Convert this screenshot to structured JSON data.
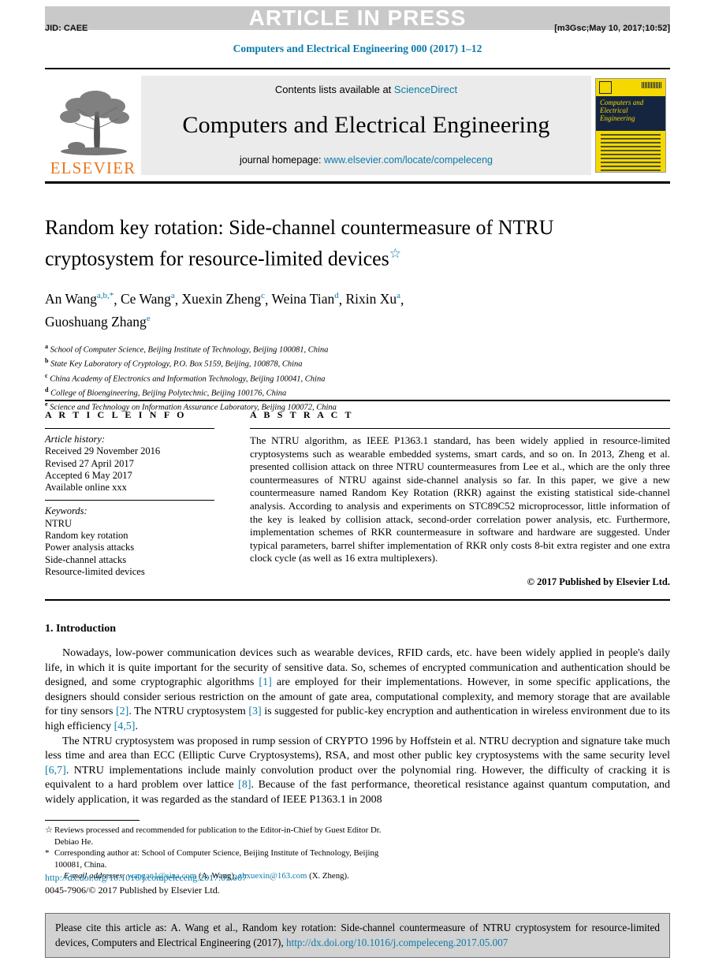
{
  "banner": {
    "article_in_press": "ARTICLE IN PRESS",
    "jid": "JID: CAEE",
    "revision_tag": "[m3Gsc;May 10, 2017;10:52]"
  },
  "journal_ref": "Computers and Electrical Engineering 000 (2017) 1–12",
  "masthead": {
    "publisher": "ELSEVIER",
    "contents_prefix": "Contents lists available at ",
    "contents_link": "ScienceDirect",
    "journal_title": "Computers and Electrical Engineering",
    "homepage_prefix": "journal homepage: ",
    "homepage_link": "www.elsevier.com/locate/compeleceng",
    "cover_title_line1": "Computers and",
    "cover_title_line2": "Electrical Engineering"
  },
  "article": {
    "title": "Random key rotation: Side-channel countermeasure of NTRU cryptosystem for resource-limited devices",
    "title_footnote_mark": "☆",
    "authors": [
      {
        "name": "An Wang",
        "sup": "a,b,*"
      },
      {
        "name": "Ce Wang",
        "sup": "a"
      },
      {
        "name": "Xuexin Zheng",
        "sup": "c"
      },
      {
        "name": "Weina Tian",
        "sup": "d"
      },
      {
        "name": "Rixin Xu",
        "sup": "a"
      },
      {
        "name": "Guoshuang Zhang",
        "sup": "e"
      }
    ],
    "affiliations": [
      {
        "mark": "a",
        "text": "School of Computer Science, Beijing Institute of Technology, Beijing 100081, China"
      },
      {
        "mark": "b",
        "text": "State Key Laboratory of Cryptology, P.O. Box 5159, Beijing, 100878, China"
      },
      {
        "mark": "c",
        "text": "China Academy of Electronics and Information Technology, Beijing 100041, China"
      },
      {
        "mark": "d",
        "text": "College of Bioengineering, Beijing Polytechnic, Beijing 100176, China"
      },
      {
        "mark": "e",
        "text": "Science and Technology on Information Assurance Laboratory, Beijing 100072, China"
      }
    ]
  },
  "article_info": {
    "heading": "A R T I C L E   I N F O",
    "history_label": "Article history:",
    "history": [
      "Received 29 November 2016",
      "Revised 27 April 2017",
      "Accepted 6 May 2017",
      "Available online xxx"
    ],
    "keywords_label": "Keywords:",
    "keywords": [
      "NTRU",
      "Random key rotation",
      "Power analysis attacks",
      "Side-channel attacks",
      "Resource-limited devices"
    ]
  },
  "abstract": {
    "heading": "A B S T R A C T",
    "text": "The NTRU algorithm, as IEEE P1363.1 standard, has been widely applied in resource-limited cryptosystems such as wearable embedded systems, smart cards, and so on. In 2013, Zheng et al. presented collision attack on three NTRU countermeasures from Lee et al., which are the only three countermeasures of NTRU against side-channel analysis so far. In this paper, we give a new countermeasure named Random Key Rotation (RKR) against the existing statistical side-channel analysis. According to analysis and experiments on STC89C52 microprocessor, little information of the key is leaked by collision attack, second-order correlation power analysis, etc. Furthermore, implementation schemes of RKR countermeasure in software and hardware are suggested. Under typical parameters, barrel shifter implementation of RKR only costs 8-bit extra register and one extra clock cycle (as well as 16 extra multiplexers).",
    "copyright": "© 2017 Published by Elsevier Ltd."
  },
  "introduction": {
    "heading": "1. Introduction",
    "paragraph1_a": "Nowadays, low-power communication devices such as wearable devices, RFID cards, etc. have been widely applied in people's daily life, in which it is quite important for the security of sensitive data. So, schemes of encrypted communication and authentication should be designed, and some cryptographic algorithms ",
    "ref1": "[1]",
    "paragraph1_b": " are employed for their implementations. However, in some specific applications, the designers should consider serious restriction on the amount of gate area, computational complexity, and memory storage that are available for tiny sensors ",
    "ref2": "[2]",
    "paragraph1_c": ". The NTRU cryptosystem ",
    "ref3": "[3]",
    "paragraph1_d": " is suggested for public-key encryption and authentication in wireless environment due to its high efficiency ",
    "ref45": "[4,5]",
    "paragraph1_e": ".",
    "paragraph2_a": "The NTRU cryptosystem was proposed in rump session of CRYPTO 1996 by Hoffstein et al. NTRU decryption and signature take much less time and area than ECC (Elliptic Curve Cryptosystems), RSA, and most other public key cryptosystems with the same security level ",
    "ref67": "[6,7]",
    "paragraph2_b": ". NTRU implementations include mainly convolution product over the polynomial ring. However, the difficulty of cracking it is equivalent to a hard problem over lattice ",
    "ref8": "[8]",
    "paragraph2_c": ". Because of the fast performance, theoretical resistance against quantum computation, and widely application, it was regarded as the standard of IEEE P1363.1 in 2008"
  },
  "footnotes": {
    "star_mark": "☆",
    "star_text": "Reviews processed and recommended for publication to the Editor-in-Chief by Guest Editor Dr. Debiao He.",
    "corresponding_mark": "*",
    "corresponding_text": "Corresponding author at: School of Computer Science, Beijing Institute of Technology, Beijing 100081, China.",
    "email_label": "E-mail addresses:",
    "email1": "wangan1@sina.com",
    "email1_owner": "(A. Wang),",
    "email2": "zhxuexin@163.com",
    "email2_owner": "(X. Zheng)."
  },
  "doi_block": {
    "doi_url": "http://dx.doi.org/10.1016/j.compeleceng.2017.05.007",
    "issn_line": "0045-7906/© 2017 Published by Elsevier Ltd."
  },
  "cite_box": {
    "text_a": "Please cite this article as: A. Wang et al., Random key rotation: Side-channel countermeasure of NTRU cryptosystem for resource-limited devices, Computers and Electrical Engineering (2017), ",
    "doi": "http://dx.doi.org/10.1016/j.compeleceng.2017.05.007"
  },
  "colors": {
    "link": "#0b7ba8",
    "elsevier_orange": "#e87722",
    "banner_gray": "#c9c9c9",
    "masthead_gray": "#ebebeb",
    "cite_box_gray": "#d2d2d2",
    "cover_yellow": "#f5d800",
    "cover_navy": "#16253f"
  }
}
